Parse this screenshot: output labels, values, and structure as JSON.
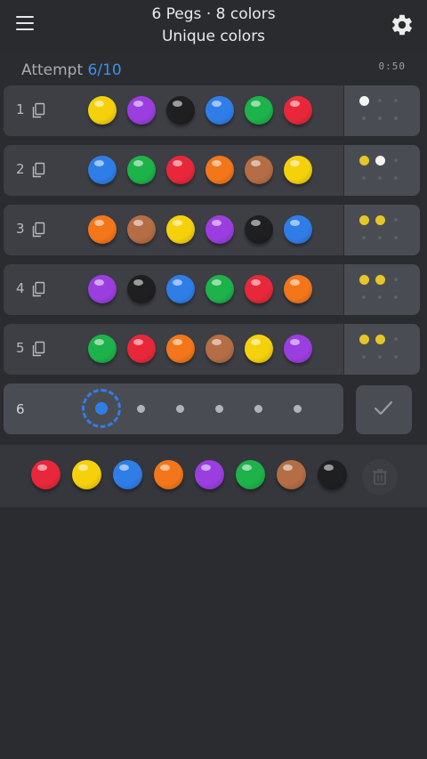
{
  "header": {
    "title_line1": "6 Pegs · 8 colors",
    "title_line2": "Unique colors"
  },
  "status": {
    "attempt_label": "Attempt",
    "attempt_count": "6/10",
    "timer": "0:50"
  },
  "colors": {
    "yellow": "#f5d10c",
    "purple": "#9b3ee0",
    "black": "#1f1f22",
    "blue": "#2f7ee8",
    "green": "#1db34a",
    "red": "#e8283a",
    "orange": "#f3761a",
    "brown": "#b46d44",
    "accent": "#3f8ef0",
    "fb_correct": "#e4c627",
    "fb_misplaced": "#f4f4f4"
  },
  "board": {
    "rows": [
      {
        "number": "1",
        "pegs": [
          "yellow",
          "purple",
          "black",
          "blue",
          "green",
          "red"
        ],
        "feedback": {
          "correct": 0,
          "misplaced": 1
        }
      },
      {
        "number": "2",
        "pegs": [
          "blue",
          "green",
          "red",
          "orange",
          "brown",
          "yellow"
        ],
        "feedback": {
          "correct": 1,
          "misplaced": 1
        }
      },
      {
        "number": "3",
        "pegs": [
          "orange",
          "brown",
          "yellow",
          "purple",
          "black",
          "blue"
        ],
        "feedback": {
          "correct": 2,
          "misplaced": 0
        }
      },
      {
        "number": "4",
        "pegs": [
          "purple",
          "black",
          "blue",
          "green",
          "red",
          "orange"
        ],
        "feedback": {
          "correct": 2,
          "misplaced": 0
        }
      },
      {
        "number": "5",
        "pegs": [
          "green",
          "red",
          "orange",
          "brown",
          "yellow",
          "purple"
        ],
        "feedback": {
          "correct": 2,
          "misplaced": 0
        }
      }
    ],
    "current": {
      "number": "6",
      "selected_slot": 1,
      "slots": 6
    }
  },
  "palette": [
    "red",
    "yellow",
    "blue",
    "orange",
    "purple",
    "green",
    "brown",
    "black"
  ],
  "icons": {
    "menu": "menu-icon",
    "settings": "gear-icon",
    "copy": "copy-icon",
    "submit": "check-icon",
    "delete": "trash-icon"
  }
}
